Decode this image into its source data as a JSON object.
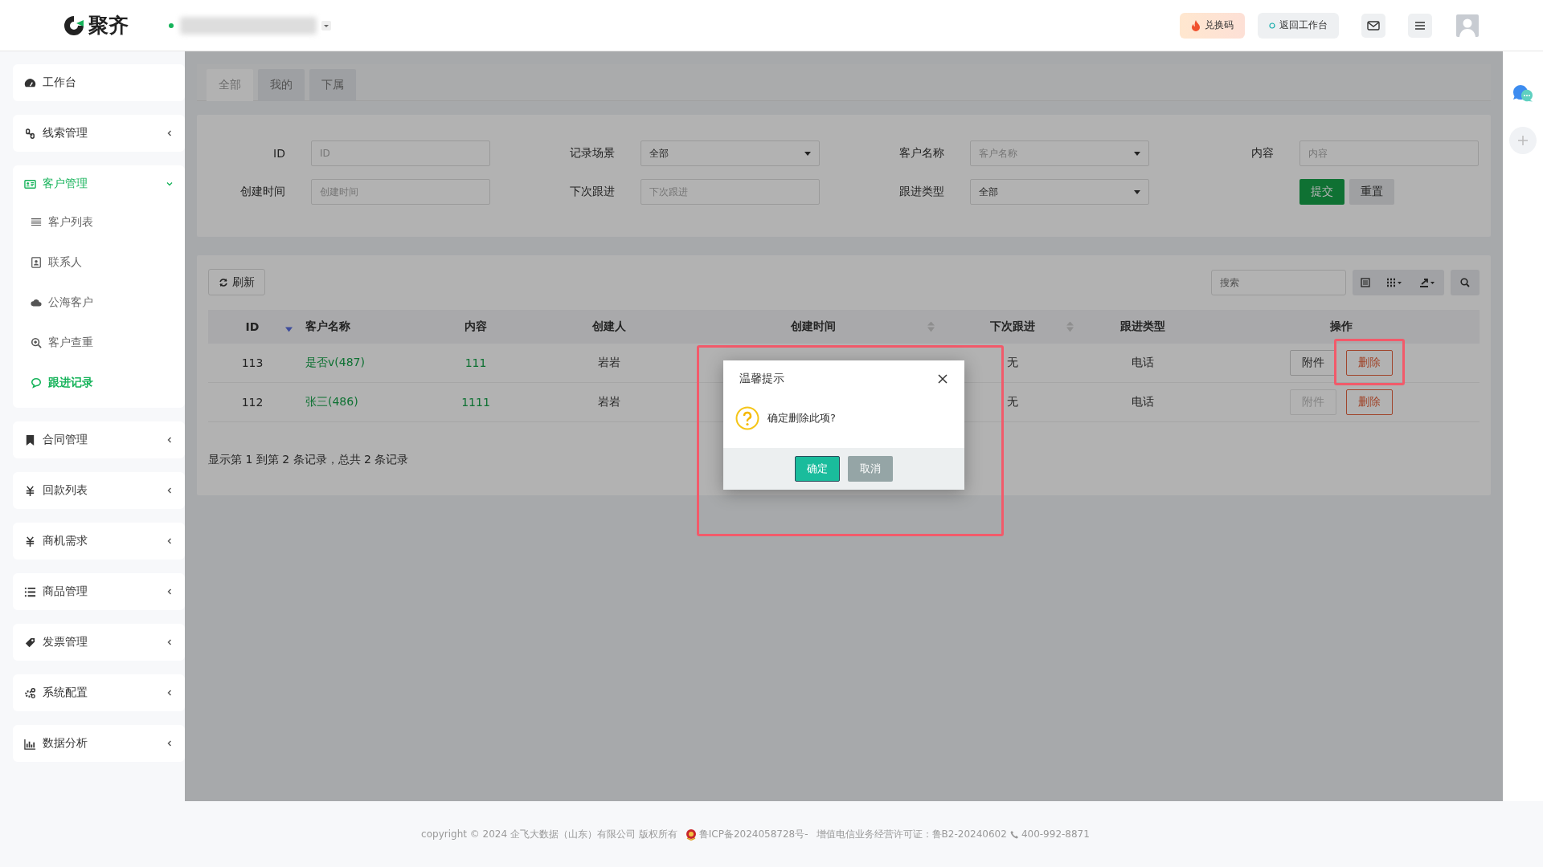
{
  "header": {
    "logo_text": "聚齐",
    "online": true,
    "buttons": [
      {
        "label": "兑换码",
        "kind": "promo"
      },
      {
        "label": "返回工作台",
        "kind": "back"
      }
    ]
  },
  "sidebar": {
    "items": [
      {
        "label": "工作台",
        "kind": "link",
        "selected": false
      },
      {
        "label": "线索管理",
        "kind": "group",
        "expanded": false,
        "selected": false
      },
      {
        "label": "客户管理",
        "kind": "group",
        "expanded": true,
        "selected": true,
        "children": [
          {
            "label": "客户列表",
            "selected": false
          },
          {
            "label": "联系人",
            "selected": false
          },
          {
            "label": "公海客户",
            "selected": false
          },
          {
            "label": "客户查重",
            "selected": false
          },
          {
            "label": "跟进记录",
            "selected": true
          }
        ]
      },
      {
        "label": "合同管理",
        "kind": "group",
        "expanded": false,
        "selected": false
      },
      {
        "label": "回款列表",
        "kind": "group",
        "expanded": false,
        "selected": false
      },
      {
        "label": "商机需求",
        "kind": "group",
        "expanded": false,
        "selected": false
      },
      {
        "label": "商品管理",
        "kind": "group",
        "expanded": false,
        "selected": false
      },
      {
        "label": "发票管理",
        "kind": "group",
        "expanded": false,
        "selected": false
      },
      {
        "label": "系统配置",
        "kind": "group",
        "expanded": false,
        "selected": false
      },
      {
        "label": "数据分析",
        "kind": "group",
        "expanded": false,
        "selected": false
      }
    ]
  },
  "tabs": [
    {
      "label": "全部",
      "selected": true
    },
    {
      "label": "我的",
      "selected": false
    },
    {
      "label": "下属",
      "selected": false
    }
  ],
  "filters": [
    {
      "label": "ID",
      "kind": "text",
      "placeholder": "ID"
    },
    {
      "label": "记录场景",
      "kind": "select",
      "value": "全部"
    },
    {
      "label": "客户名称",
      "kind": "select",
      "placeholder": "客户名称"
    },
    {
      "label": "内容",
      "kind": "text",
      "placeholder": "内容"
    },
    {
      "label": "创建时间",
      "kind": "text",
      "placeholder": "创建时间"
    },
    {
      "label": "下次跟进",
      "kind": "text",
      "placeholder": "下次跟进"
    },
    {
      "label": "跟进类型",
      "kind": "select",
      "value": "全部"
    }
  ],
  "filter_buttons": [
    {
      "label": "提交",
      "kind": "primary"
    },
    {
      "label": "重置",
      "kind": "default"
    }
  ],
  "toolbar": {
    "refresh": "刷新",
    "search": {
      "placeholder": "搜索"
    }
  },
  "table": {
    "columns": [
      {
        "label": "ID",
        "sortable": true,
        "sorted": true
      },
      {
        "label": "客户名称",
        "sortable": false,
        "sorted": false
      },
      {
        "label": "内容",
        "sortable": false,
        "sorted": false
      },
      {
        "label": "创建人",
        "sortable": false,
        "sorted": false
      },
      {
        "label": "创建时间",
        "sortable": true,
        "sorted": false
      },
      {
        "label": "下次跟进",
        "sortable": true,
        "sorted": false
      },
      {
        "label": "跟进类型",
        "sortable": false,
        "sorted": false
      },
      {
        "label": "操作",
        "sortable": false,
        "sorted": false
      }
    ],
    "rows": [
      {
        "id": "113",
        "customer": "是否v(487)",
        "content": "111",
        "creator": "岩岩",
        "next": "无",
        "type": "电话",
        "actions": [
          {
            "label": "附件",
            "kind": "attach",
            "disabled": false
          },
          {
            "label": "删除",
            "kind": "delete",
            "disabled": false,
            "highlighted": true
          }
        ]
      },
      {
        "id": "112",
        "customer": "张三(486)",
        "content": "1111",
        "creator": "岩岩",
        "next": "无",
        "type": "电话",
        "actions": [
          {
            "label": "附件",
            "kind": "attach",
            "disabled": true
          },
          {
            "label": "删除",
            "kind": "delete",
            "disabled": false,
            "highlighted": false
          }
        ]
      }
    ],
    "summary": "显示第 1 到第 2 条记录，总共 2 条记录"
  },
  "dialog": {
    "title": "温馨提示",
    "message": "确定删除此项?",
    "highlighted": true,
    "buttons": [
      {
        "label": "确定",
        "kind": "primary"
      },
      {
        "label": "取消",
        "kind": "default"
      }
    ]
  },
  "footer": {
    "copyright": "copyright © 2024 企飞大数据（山东）有限公司 版权所有",
    "icp": "鲁ICP备2024058728号-",
    "license": "增值电信业务经营许可证：鲁B2-20240602",
    "phone": "400-992-8871"
  }
}
